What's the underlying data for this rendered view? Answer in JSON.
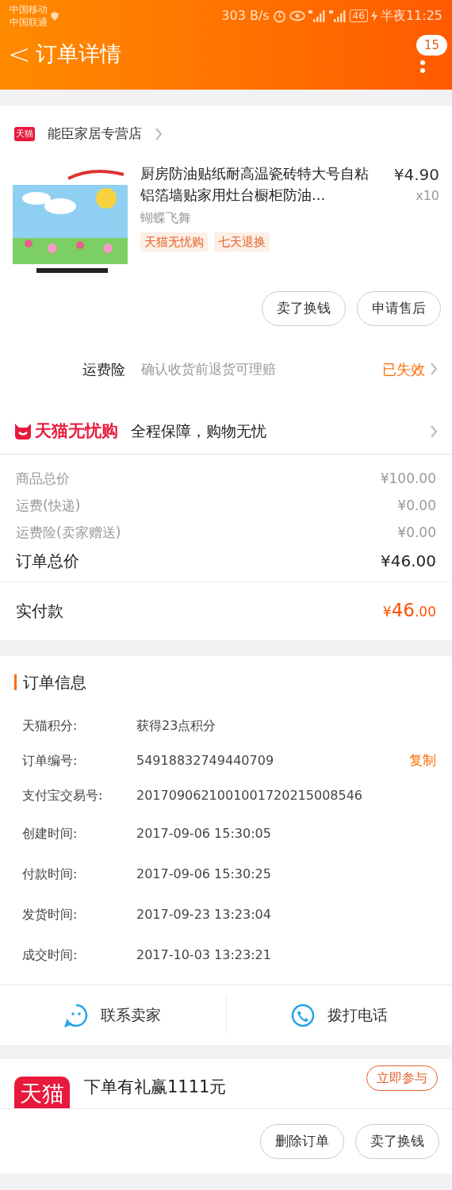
{
  "status_bar": {
    "carriers": [
      "中国移动",
      "中国联通"
    ],
    "speed": "303 B/s",
    "battery": "46",
    "time": "半夜11:25"
  },
  "header": {
    "back": "<",
    "title": "订单详情",
    "badge": "15"
  },
  "store": {
    "logo": "天猫",
    "name": "能臣家居专营店"
  },
  "product": {
    "title": "厨房防油贴纸耐高温瓷砖特大号自粘铝箔墙贴家用灶台橱柜防油...",
    "price": "¥4.90",
    "qty": "x10",
    "variant": "蝴蝶飞舞",
    "tags": [
      "天猫无忧购",
      "七天退换"
    ],
    "image": {
      "kind": "picture"
    }
  },
  "product_buttons": [
    "卖了换钱",
    "申请售后"
  ],
  "insurance": {
    "label": "运费险",
    "desc": "确认收货前退货可理赔",
    "status": "已失效"
  },
  "guarantee": {
    "brand": "天猫无忧购",
    "text": "全程保障，购物无忧"
  },
  "price_lines": [
    {
      "label": "商品总价",
      "value": "¥100.00"
    },
    {
      "label": "运费(快递)",
      "value": "¥0.00"
    },
    {
      "label": "运费险(卖家赠送)",
      "value": "¥0.00"
    }
  ],
  "order_total": {
    "label": "订单总价",
    "value": "¥46.00"
  },
  "paid": {
    "label": "实付款",
    "currency": "¥",
    "integer": "46",
    "decimal": ".00"
  },
  "order_info": {
    "title": "订单信息",
    "rows": [
      {
        "label": "天猫积分:",
        "value": "获得23点积分"
      },
      {
        "label": "订单编号:",
        "value": "54918832749440709",
        "action": "复制"
      },
      {
        "label": "支付宝交易号:",
        "value": "2017090621001001720215008546"
      },
      {
        "label": "创建时间:",
        "value": "2017-09-06 15:30:05"
      },
      {
        "label": "付款时间:",
        "value": "2017-09-06 15:30:25"
      },
      {
        "label": "发货时间:",
        "value": "2017-09-23 13:23:04"
      },
      {
        "label": "成交时间:",
        "value": "2017-10-03 13:23:21"
      }
    ]
  },
  "contact": [
    {
      "kind": "chat",
      "label": "联系卖家"
    },
    {
      "kind": "phone",
      "label": "拨打电话"
    }
  ],
  "promo": {
    "logo": "天猫",
    "text": "下单有礼赢1111元",
    "button": "立即参与"
  },
  "bottom_buttons": [
    "删除订单",
    "卖了换钱"
  ]
}
